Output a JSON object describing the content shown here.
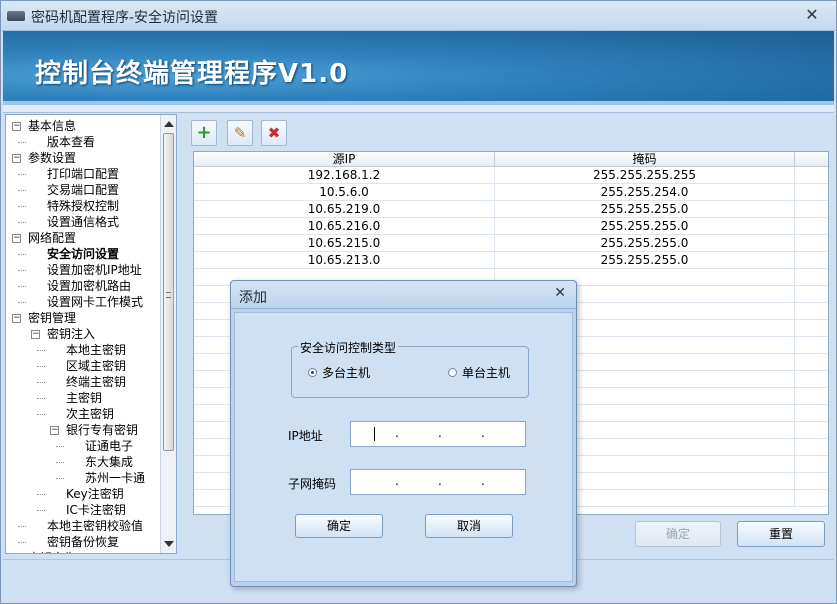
{
  "window": {
    "title": "密码机配置程序-安全访问设置",
    "close": "✕"
  },
  "banner": {
    "title": "控制台终端管理程序V1.0"
  },
  "tree": {
    "nodes": [
      {
        "label": "基本信息",
        "expander": "−"
      },
      {
        "label": "版本查看"
      },
      {
        "label": "参数设置",
        "expander": "−"
      },
      {
        "label": "打印端口配置"
      },
      {
        "label": "交易端口配置"
      },
      {
        "label": "特殊授权控制"
      },
      {
        "label": "设置通信格式"
      },
      {
        "label": "网络配置",
        "expander": "−"
      },
      {
        "label": "安全访问设置",
        "bold": true
      },
      {
        "label": "设置加密机IP地址"
      },
      {
        "label": "设置加密机路由"
      },
      {
        "label": "设置网卡工作模式"
      },
      {
        "label": "密钥管理",
        "expander": "−"
      },
      {
        "label": "密钥注入",
        "expander": "−"
      },
      {
        "label": "本地主密钥"
      },
      {
        "label": "区域主密钥"
      },
      {
        "label": "终端主密钥"
      },
      {
        "label": "主密钥"
      },
      {
        "label": "次主密钥"
      },
      {
        "label": "银行专有密钥",
        "expander": "−"
      },
      {
        "label": "证通电子"
      },
      {
        "label": "东大集成"
      },
      {
        "label": "苏州一卡通"
      },
      {
        "label": "Key注密钥"
      },
      {
        "label": "IC卡注密钥"
      },
      {
        "label": "本地主密钥校验值"
      },
      {
        "label": "密钥备份恢复"
      },
      {
        "label": "密钥产生",
        "expander": "−"
      }
    ]
  },
  "toolbar": {
    "add_icon": "+",
    "edit_icon": "✎",
    "delete_icon": "✖"
  },
  "table": {
    "columns": [
      "源IP",
      "掩码"
    ],
    "rows": [
      [
        "192.168.1.2",
        "255.255.255.255"
      ],
      [
        "10.5.6.0",
        "255.255.254.0"
      ],
      [
        "10.65.219.0",
        "255.255.255.0"
      ],
      [
        "10.65.216.0",
        "255.255.255.0"
      ],
      [
        "10.65.215.0",
        "255.255.255.0"
      ],
      [
        "10.65.213.0",
        "255.255.255.0"
      ]
    ]
  },
  "buttons": {
    "confirm": "确定",
    "reset": "重置"
  },
  "dialog": {
    "title": "添加",
    "close": "✕",
    "group_title": "安全访问控制类型",
    "radio_multi": "多台主机",
    "radio_single": "单台主机",
    "ip_label": "IP地址",
    "mask_label": "子网掩码",
    "ok": "确定",
    "cancel": "取消"
  }
}
